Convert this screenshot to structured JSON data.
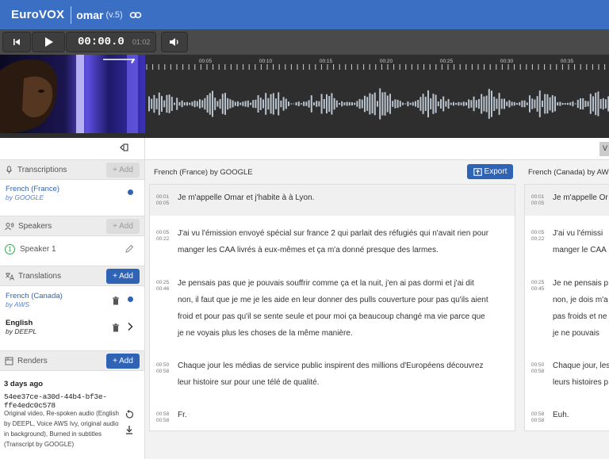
{
  "header": {
    "brand_euro": "Euro",
    "brand_vox": "VOX",
    "project": "omar",
    "version": "(v.5)",
    "link_icon": "link-icon"
  },
  "player": {
    "current_time": "00:00.0",
    "duration": "01:02"
  },
  "timeline": {
    "ticks": [
      "00:05",
      "00:10",
      "00:15",
      "00:20",
      "00:25",
      "00:30",
      "00:35"
    ]
  },
  "sidebar": {
    "transcriptions": {
      "label": "Transcriptions",
      "add": "+ Add",
      "items": [
        {
          "lang": "French (France)",
          "by": "by GOOGLE"
        }
      ]
    },
    "speakers": {
      "label": "Speakers",
      "add": "+ Add",
      "items": [
        {
          "num": "1",
          "name": "Speaker 1"
        }
      ]
    },
    "translations": {
      "label": "Translations",
      "add": "+ Add",
      "items": [
        {
          "lang": "French (Canada)",
          "by": "by AWS"
        },
        {
          "lang": "English",
          "by": "by DEEPL"
        }
      ]
    },
    "renders": {
      "label": "Renders",
      "add": "+ Add",
      "date": "3 days ago",
      "id": "54ee37ce-a30d-44b4-bf3e-ffe4edc0c578",
      "description": "Original video, Re-spoken audio (English by DEEPL, Voice AWS Ivy, original audio in background), Burned in subtitles (Transcript by GOOGLE)"
    }
  },
  "toolbar": {
    "right_btn": "V"
  },
  "panel_main": {
    "title": "French (France) by GOOGLE",
    "export": "Export",
    "segments": [
      {
        "start": "00:01",
        "end": "00:05",
        "lines": [
          "Je m'appelle Omar et j'habite à à Lyon."
        ]
      },
      {
        "start": "00:05",
        "end": "00:22",
        "lines": [
          "J'ai vu l'émission envoyé spécial sur france 2 qui parlait des réfugiés qui n'avait rien pour",
          "manger les CAA livrés à eux-mêmes et ça m'a donné presque des larmes."
        ]
      },
      {
        "start": "00:25",
        "end": "00:46",
        "lines": [
          "Je pensais pas que je pouvais souffrir comme ça et la nuit, j'en ai pas dormi et j'ai dit",
          "non, il faut que je me je les aide en leur donner des pulls couverture pour pas qu'ils aient",
          "froid et pour pas qu'il se sente seule et pour moi ça beaucoup changé ma vie parce que",
          "je ne voyais plus les choses de la même manière."
        ]
      },
      {
        "start": "00:50",
        "end": "00:58",
        "lines": [
          "Chaque jour les médias de service public inspirent des millions d'Européens découvrez",
          "leur histoire sur pour une télé de qualité."
        ]
      },
      {
        "start": "00:58",
        "end": "00:58",
        "lines": [
          "Fr."
        ]
      }
    ]
  },
  "panel_second": {
    "title": "French (Canada) by AW",
    "segments": [
      {
        "start": "00:01",
        "end": "00:05",
        "lines": [
          "Je m'appelle Or"
        ]
      },
      {
        "start": "00:05",
        "end": "00:22",
        "lines": [
          "J'ai vu l'émissi",
          "manger le CAA"
        ]
      },
      {
        "start": "00:25",
        "end": "00:45",
        "lines": [
          "Je ne pensais p",
          "non, je dois m'a",
          "pas froids et ne",
          "je ne pouvais"
        ]
      },
      {
        "start": "00:50",
        "end": "00:58",
        "lines": [
          "Chaque jour, les",
          "leurs histoires p"
        ]
      },
      {
        "start": "00:58",
        "end": "00:58",
        "lines": [
          "Euh."
        ]
      }
    ]
  },
  "colors": {
    "header": "#3a6fc4",
    "accent": "#2f63b5",
    "player": "#4a4a4a",
    "waveform": "#b9c4cf"
  }
}
